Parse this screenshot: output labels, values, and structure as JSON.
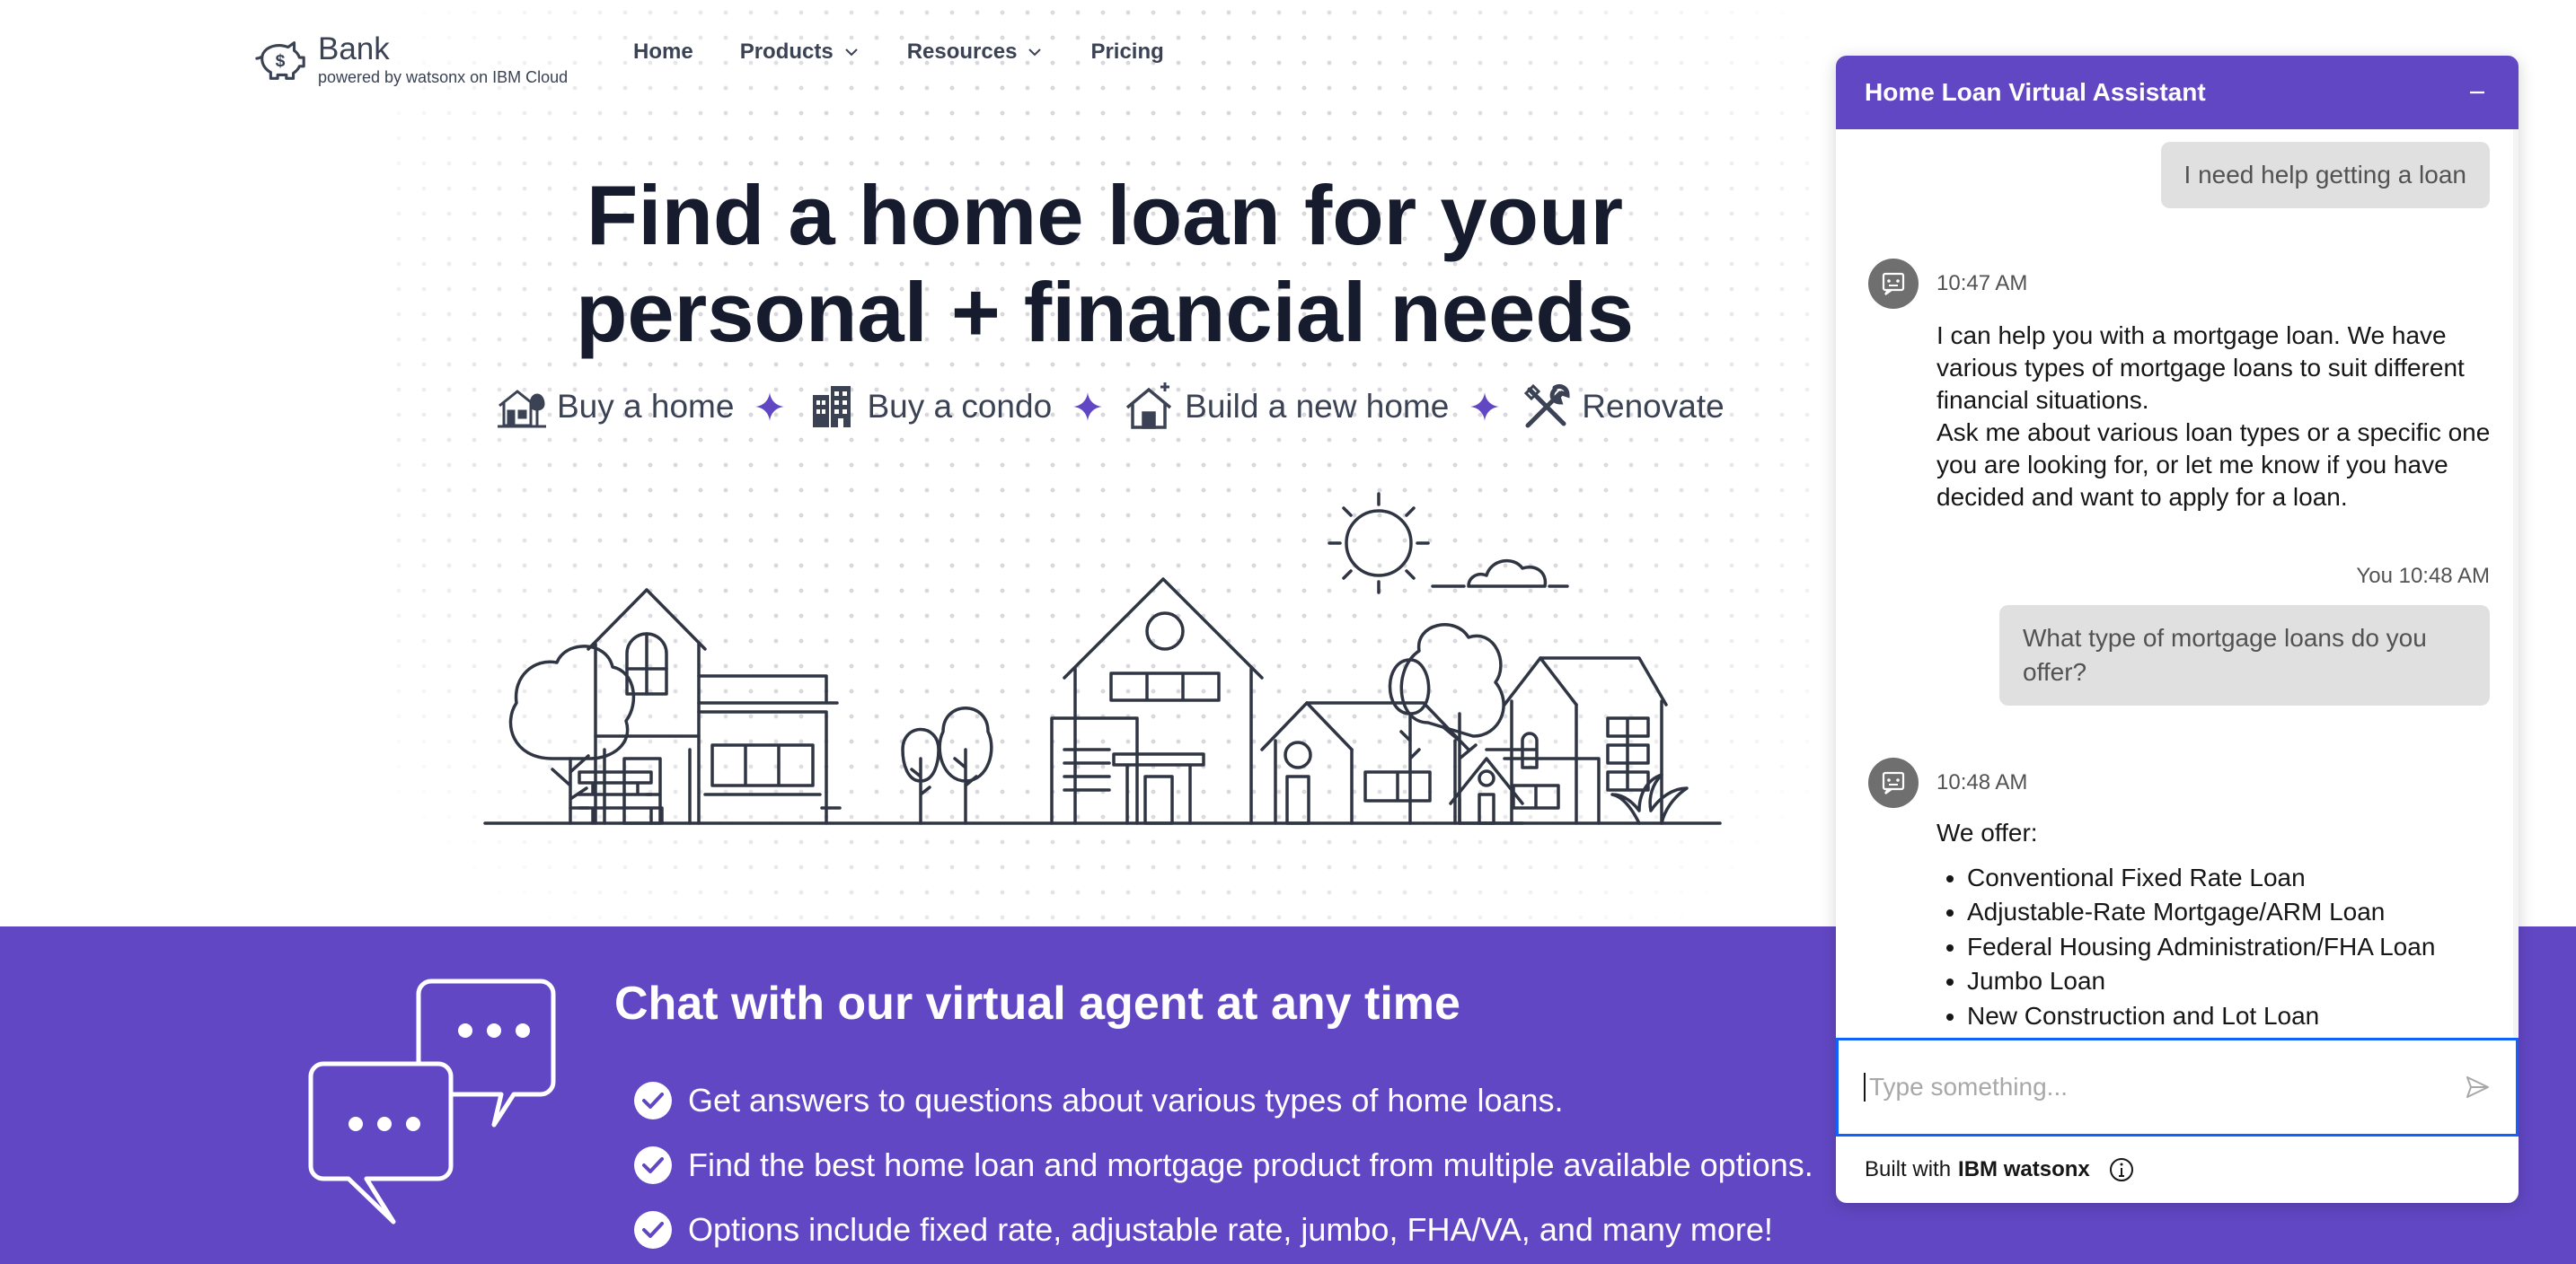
{
  "brand": {
    "name": "Bank",
    "tagline": "powered by watsonx on IBM Cloud"
  },
  "nav": [
    {
      "label": "Home"
    },
    {
      "label": "Products"
    },
    {
      "label": "Resources"
    },
    {
      "label": "Pricing"
    }
  ],
  "hero": {
    "title_line1": "Find a home loan for your",
    "title_line2": "personal + financial needs",
    "features": [
      "Buy a home",
      "Buy a condo",
      "Build a new home",
      "Renovate"
    ]
  },
  "band": {
    "title": "Chat with our virtual agent at any time",
    "points": [
      "Get answers to questions about various types of home loans.",
      "Find the best home loan and mortgage product from multiple available options.",
      "Options include fixed rate, adjustable rate, jumbo, FHA/VA, and many more!"
    ]
  },
  "chat": {
    "title": "Home Loan Virtual Assistant",
    "messages": {
      "user1": "I need help getting a loan",
      "bot1_time": "10:47 AM",
      "bot1_text_a": "I can help you with a mortgage loan. We have various types of mortgage loans to suit different financial situations.",
      "bot1_text_b": "Ask me about various loan types or a specific one you are looking for, or let me know if you have decided and want to apply for a loan.",
      "user2_meta": "You 10:48 AM",
      "user2": "What type of mortgage loans do you offer?",
      "bot2_time": "10:48 AM",
      "bot2_intro": "We offer:",
      "bot2_list": [
        "Conventional Fixed Rate Loan",
        "Adjustable-Rate Mortgage/ARM Loan",
        "Federal Housing Administration/FHA Loan",
        "Jumbo Loan",
        "New Construction and Lot Loan"
      ]
    },
    "input_placeholder": "Type something...",
    "footer_prefix": "Built with",
    "footer_brand": "IBM watsonx"
  },
  "colors": {
    "accent": "#6247c4",
    "focus": "#0f62fe",
    "ink": "#161c2d"
  }
}
